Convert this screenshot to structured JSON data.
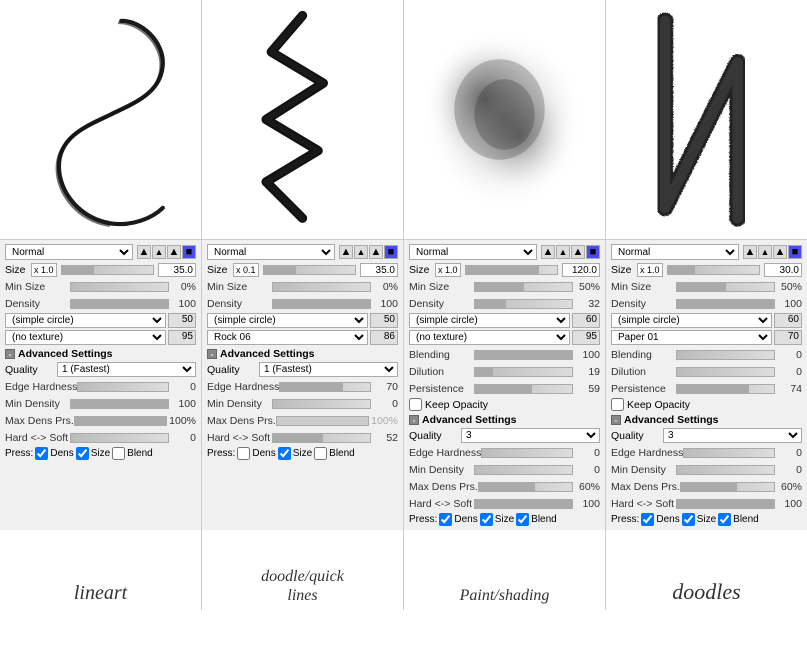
{
  "panels": [
    {
      "id": "lineart",
      "mode": "Normal",
      "size_mult": "x 1.0",
      "size_val": "35.0",
      "min_size": "0%",
      "density": "100",
      "brush1": "(simple circle)",
      "brush1_val": "50",
      "brush2": "(no texture)",
      "brush2_val": "95",
      "blending": null,
      "dilution": null,
      "persistence": null,
      "keep_opacity": false,
      "quality": "1 (Fastest)",
      "edge_hardness": "0",
      "min_density": "100",
      "max_dens_prs": "100%",
      "hard_soft": "0",
      "press_dens": true,
      "press_size": true,
      "press_blend": false,
      "has_blending": false,
      "label": "lineart",
      "label_size": "large"
    },
    {
      "id": "doodle",
      "mode": "Normal",
      "size_mult": "x 0.1",
      "size_val": "35.0",
      "min_size": "0%",
      "density": "100",
      "brush1": "(simple circle)",
      "brush1_val": "50",
      "brush2": "Rock 06",
      "brush2_val": "86",
      "blending": null,
      "dilution": null,
      "persistence": null,
      "keep_opacity": false,
      "quality": "1 (Fastest)",
      "edge_hardness": "70",
      "min_density": "0",
      "max_dens_prs": "100%",
      "hard_soft": "52",
      "press_dens": false,
      "press_size": true,
      "press_blend": false,
      "has_blending": false,
      "label": "doodle/quick\nlines",
      "label_size": "normal"
    },
    {
      "id": "paint",
      "mode": "Normal",
      "size_mult": "x 1.0",
      "size_val": "120.0",
      "min_size": "50%",
      "density": "32",
      "brush1": "(simple circle)",
      "brush1_val": "60",
      "brush2": "(no texture)",
      "brush2_val": "95",
      "blending": "100",
      "dilution": "19",
      "persistence": "59",
      "keep_opacity": false,
      "quality": "3",
      "edge_hardness": "0",
      "min_density": "0",
      "max_dens_prs": "60%",
      "hard_soft": "100",
      "press_dens": true,
      "press_size": true,
      "press_blend": true,
      "has_blending": true,
      "label": "Paint/shading",
      "label_size": "normal"
    },
    {
      "id": "doodles",
      "mode": "Normal",
      "size_mult": "x 1.0",
      "size_val": "30.0",
      "min_size": "50%",
      "density": "100",
      "brush1": "(simple circle)",
      "brush1_val": "60",
      "brush2": "Paper 01",
      "brush2_val": "70",
      "blending": "0",
      "dilution": "0",
      "persistence": "74",
      "keep_opacity": false,
      "quality": "3",
      "edge_hardness": "0",
      "min_density": "0",
      "max_dens_prs": "60%",
      "hard_soft": "100",
      "press_dens": true,
      "press_size": true,
      "press_blend": true,
      "has_blending": true,
      "label": "doodles",
      "label_size": "large"
    }
  ],
  "ui": {
    "advanced_settings": "Advanced Settings",
    "quality_label": "Quality",
    "edge_hardness_label": "Edge Hardness",
    "min_density_label": "Min Density",
    "max_dens_label": "Max Dens Prs.",
    "hard_soft_label": "Hard <-> Soft",
    "press_label": "Press:",
    "dens_label": "Dens",
    "size_label": "Size",
    "blend_label": "Blend",
    "size_row_label": "Size",
    "min_size_label": "Min Size",
    "density_label": "Density",
    "blending_label": "Blending",
    "dilution_label": "Dilution",
    "persistence_label": "Persistence",
    "keep_opacity_label": "Keep Opacity",
    "collapse_icon": "-"
  }
}
